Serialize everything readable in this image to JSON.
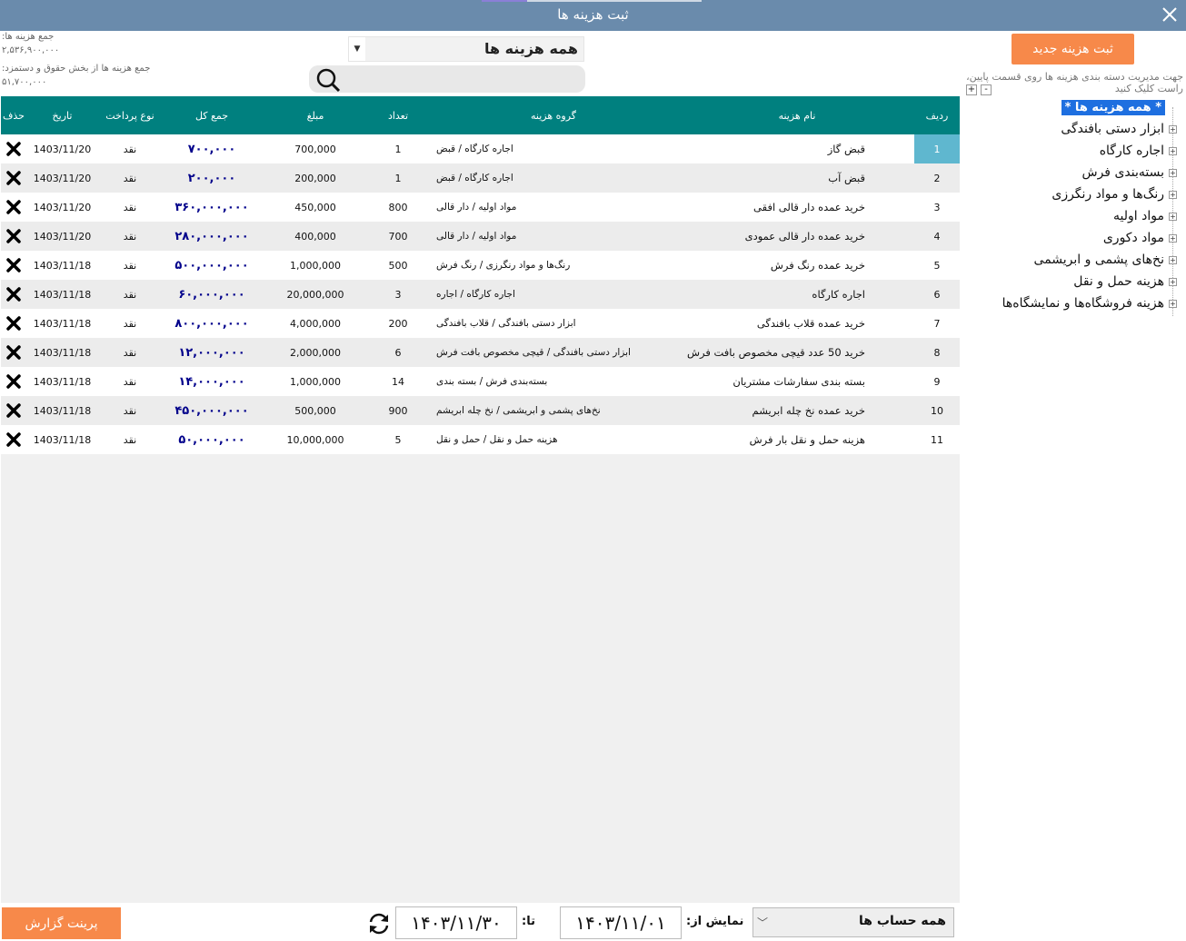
{
  "window": {
    "title": "ثبت هزینه ها"
  },
  "summary": {
    "total_label": "جمع هزینه ها:",
    "total_value": "۲,۵۳۶,۹۰۰,۰۰۰",
    "salary_label": "جمع هزینه ها از بخش حقوق و دستمزد:",
    "salary_value": "۵۱,۷۰۰,۰۰۰"
  },
  "filter": {
    "category_selected": "همه هزینه ها",
    "search_placeholder": ""
  },
  "table": {
    "headers": {
      "row": "ردیف",
      "name": "نام هزینه",
      "group": "گروه هزینه",
      "count": "تعداد",
      "amount": "مبلغ",
      "total": "جمع کل",
      "pay_type": "نوع پرداخت",
      "date": "تاریخ",
      "delete": "حذف"
    },
    "rows": [
      {
        "no": "1",
        "name": "قبض گاز",
        "group": "اجاره کارگاه / قبض",
        "count": "1",
        "amount": "700,000",
        "total": "۷۰۰,۰۰۰",
        "pay": "نقد",
        "date": "1403/11/20"
      },
      {
        "no": "2",
        "name": "قبض آب",
        "group": "اجاره کارگاه / قبض",
        "count": "1",
        "amount": "200,000",
        "total": "۲۰۰,۰۰۰",
        "pay": "نقد",
        "date": "1403/11/20"
      },
      {
        "no": "3",
        "name": "خرید عمده دار قالی افقی",
        "group": "مواد اولیه / دار قالی",
        "count": "800",
        "amount": "450,000",
        "total": "۳۶۰,۰۰۰,۰۰۰",
        "pay": "نقد",
        "date": "1403/11/20"
      },
      {
        "no": "4",
        "name": "خرید عمده دار قالی عمودی",
        "group": "مواد اولیه / دار قالی",
        "count": "700",
        "amount": "400,000",
        "total": "۲۸۰,۰۰۰,۰۰۰",
        "pay": "نقد",
        "date": "1403/11/20"
      },
      {
        "no": "5",
        "name": "خرید عمده رنگ فرش",
        "group": "رنگ‌ها و مواد رنگرزی / رنگ فرش",
        "count": "500",
        "amount": "1,000,000",
        "total": "۵۰۰,۰۰۰,۰۰۰",
        "pay": "نقد",
        "date": "1403/11/18"
      },
      {
        "no": "6",
        "name": "اجاره کارگاه",
        "group": "اجاره کارگاه / اجاره",
        "count": "3",
        "amount": "20,000,000",
        "total": "۶۰,۰۰۰,۰۰۰",
        "pay": "نقد",
        "date": "1403/11/18"
      },
      {
        "no": "7",
        "name": "خرید عمده قلاب بافندگی",
        "group": "ابزار دستی بافندگی / قلاب بافندگی",
        "count": "200",
        "amount": "4,000,000",
        "total": "۸۰۰,۰۰۰,۰۰۰",
        "pay": "نقد",
        "date": "1403/11/18"
      },
      {
        "no": "8",
        "name": "خرید 50 عدد قیچی مخصوص بافت فرش",
        "group": "ابزار دستی بافندگی / قیچی مخصوص بافت فرش",
        "count": "6",
        "amount": "2,000,000",
        "total": "۱۲,۰۰۰,۰۰۰",
        "pay": "نقد",
        "date": "1403/11/18"
      },
      {
        "no": "9",
        "name": "بسته بندی سفارشات مشتریان",
        "group": "بسته‌بندی فرش / بسته بندی",
        "count": "14",
        "amount": "1,000,000",
        "total": "۱۴,۰۰۰,۰۰۰",
        "pay": "نقد",
        "date": "1403/11/18"
      },
      {
        "no": "10",
        "name": "خرید عمده نخ چله ابریشم",
        "group": "نخ‌های پشمی و ابریشمی / نخ چله ابریشم",
        "count": "900",
        "amount": "500,000",
        "total": "۴۵۰,۰۰۰,۰۰۰",
        "pay": "نقد",
        "date": "1403/11/18"
      },
      {
        "no": "11",
        "name": "هزینه حمل و نقل بار فرش",
        "group": "هزینه حمل و نقل / حمل و نقل",
        "count": "5",
        "amount": "10,000,000",
        "total": "۵۰,۰۰۰,۰۰۰",
        "pay": "نقد",
        "date": "1403/11/18"
      }
    ]
  },
  "sidebar": {
    "new_button": "ثبت هزینه جدید",
    "hint": "جهت مدیریت دسته بندی هزینه ها روی قسمت پایین، راست کلیک کنید",
    "plus": "+",
    "minus": "-",
    "tree_root": "* همه هزینه ها *",
    "tree_items": [
      "ابزار دستی بافندگی",
      "اجاره کارگاه",
      "بسته‌بندی فرش",
      "رنگ‌ها و مواد رنگرزی",
      "مواد اولیه",
      "مواد دکوری",
      "نخ‌های پشمی و ابریشمی",
      "هزینه حمل و نقل",
      "هزینه فروشگاه‌ها و نمایشگاه‌ها"
    ]
  },
  "footer": {
    "print_button": "پرینت گزارش",
    "to_label": "تا:",
    "to_date": "۱۴۰۳/۱۱/۳۰",
    "from_label": "نمایش از:",
    "from_date": "۱۴۰۳/۱۱/۰۱",
    "account_selected": "همه حساب ها"
  },
  "colors": {
    "titlebar": "#6a8bac",
    "header": "#00807f",
    "accent": "#f7894a",
    "total_text": "#00008b",
    "selected_row": "#5fb7cf",
    "tree_selected": "#1e6fe0"
  },
  "icons": {
    "close": "close-icon",
    "search": "search-icon",
    "delete": "delete-x-icon",
    "refresh": "refresh-icon",
    "expand": "expand-plus-icon"
  }
}
